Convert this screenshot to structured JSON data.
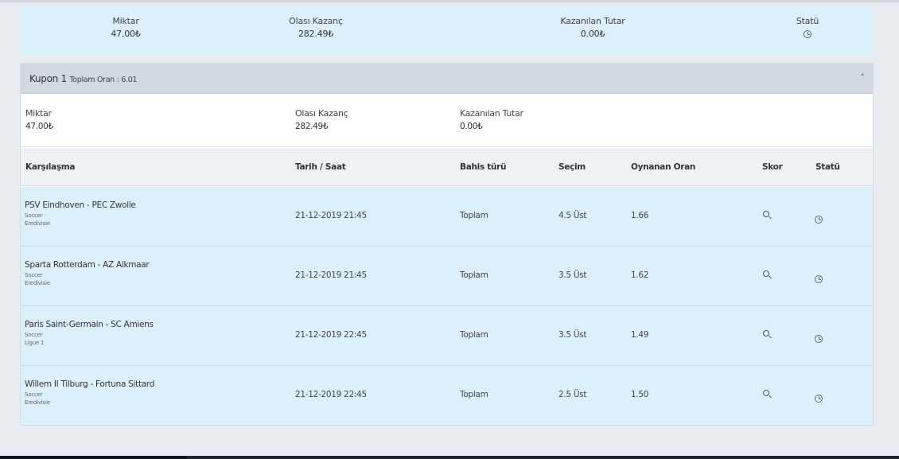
{
  "summary": {
    "amount_label": "Miktar",
    "amount_value": "47.00₺",
    "possible_win_label": "Olası Kazanç",
    "possible_win_value": "282.49₺",
    "won_amount_label": "Kazanılan Tutar",
    "won_amount_value": "0.00₺",
    "status_label": "Statü",
    "status_icon": "clock-icon"
  },
  "coupon": {
    "title": "Kupon 1",
    "total_odds_text": "Toplam Oran : 6.01",
    "collapse_icon": "chevron-up-icon",
    "collapse_glyph": "˄",
    "info": {
      "amount_label": "Miktar",
      "amount_value": "47.00₺",
      "possible_win_label": "Olası Kazanç",
      "possible_win_value": "282.49₺",
      "won_amount_label": "Kazanılan Tutar",
      "won_amount_value": "0.00₺"
    },
    "columns": [
      "Karşılaşma",
      "Tarih / Saat",
      "Bahis türü",
      "Seçim",
      "Oynanan Oran",
      "Skor",
      "Statü"
    ],
    "rows": [
      {
        "match": "PSV Eindhoven - PEC Zwolle",
        "sport": "Soccer",
        "league": "Eredivisie",
        "datetime": "21-12-2019 21:45",
        "bet_type": "Toplam",
        "selection": "4.5 Üst",
        "odds": "1.66",
        "score_icon": "search-icon",
        "status_icon": "clock-icon"
      },
      {
        "match": "Sparta Rotterdam - AZ Alkmaar",
        "sport": "Soccer",
        "league": "Eredivisie",
        "datetime": "21-12-2019 21:45",
        "bet_type": "Toplam",
        "selection": "3.5 Üst",
        "odds": "1.62",
        "score_icon": "search-icon",
        "status_icon": "clock-icon"
      },
      {
        "match": "Paris Saint-Germain - SC Amiens",
        "sport": "Soccer",
        "league": "Ligue 1",
        "datetime": "21-12-2019 22:45",
        "bet_type": "Toplam",
        "selection": "3.5 Üst",
        "odds": "1.49",
        "score_icon": "search-icon",
        "status_icon": "clock-icon"
      },
      {
        "match": "Willem II Tilburg - Fortuna Sittard",
        "sport": "Soccer",
        "league": "Eredivisie",
        "datetime": "21-12-2019 22:45",
        "bet_type": "Toplam",
        "selection": "2.5 Üst",
        "odds": "1.50",
        "score_icon": "search-icon",
        "status_icon": "clock-icon"
      }
    ]
  },
  "colors": {
    "row_bg": "#dcf0fc",
    "header_bg": "#d3d9e1",
    "page_bg": "#e8ecf1"
  }
}
